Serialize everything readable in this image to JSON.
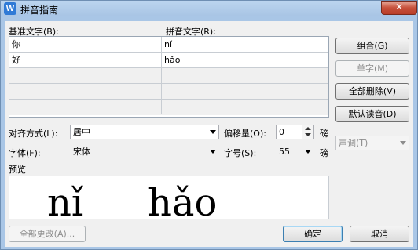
{
  "window": {
    "title": "拼音指南",
    "close_glyph": "✕"
  },
  "headers": {
    "base_text": "基准文字(B):",
    "ruby_text": "拼音文字(R):"
  },
  "rows": [
    {
      "base": "你",
      "ruby": "nǐ"
    },
    {
      "base": "好",
      "ruby": "hǎo"
    },
    {
      "base": "",
      "ruby": ""
    },
    {
      "base": "",
      "ruby": ""
    },
    {
      "base": "",
      "ruby": ""
    }
  ],
  "buttons": {
    "group": "组合(G)",
    "mono": "单字(M)",
    "clear_all": "全部删除(V)",
    "default_reading": "默认读音(D)",
    "tone": "声调(T)",
    "change_all": "全部更改(A)...",
    "ok": "确定",
    "cancel": "取消"
  },
  "alignment": {
    "label": "对齐方式(L):",
    "value": "居中"
  },
  "offset": {
    "label": "偏移量(O):",
    "value": "0",
    "unit": "磅"
  },
  "font": {
    "label": "字体(F):",
    "value": "宋体"
  },
  "size": {
    "label": "字号(S):",
    "value": "55",
    "unit": "磅"
  },
  "preview": {
    "label": "预览",
    "syllables": [
      "nǐ",
      "hǎo"
    ]
  }
}
